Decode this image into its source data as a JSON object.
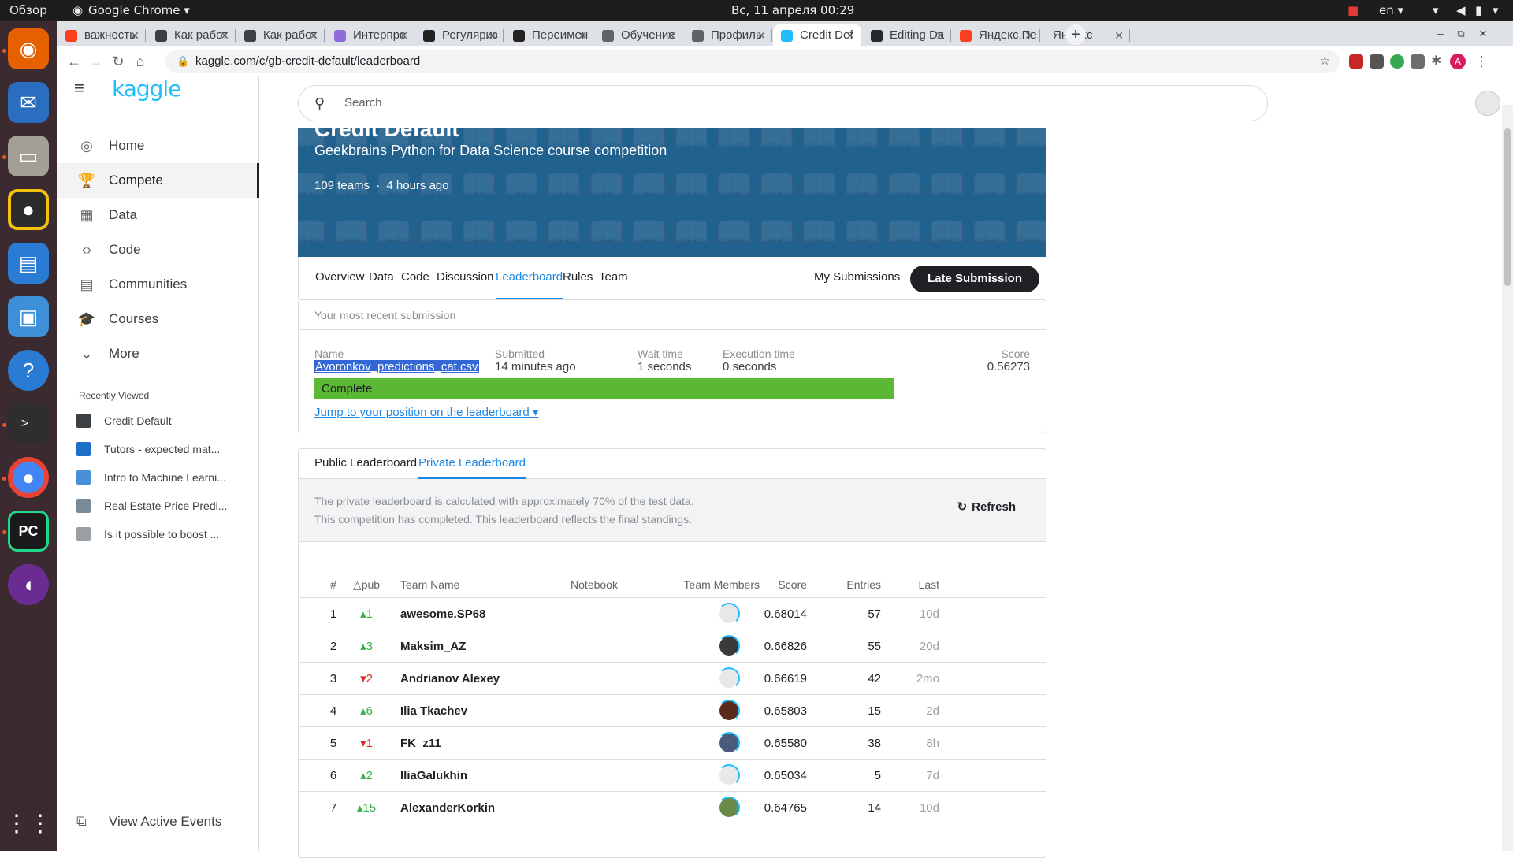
{
  "topbar": {
    "activities": "Обзор",
    "app_menu": "Google Chrome ▾",
    "clock": "Вс, 11 апреля  00:29",
    "lang": "en ▾"
  },
  "browser": {
    "tabs": [
      {
        "label": "важность",
        "favicon_color": "#fc3f1d"
      },
      {
        "label": "Как работ",
        "favicon_color": "#3c4043"
      },
      {
        "label": "Как работ",
        "favicon_color": "#3c4043"
      },
      {
        "label": "Интерпре",
        "favicon_color": "#8e6cd9"
      },
      {
        "label": "Регуляриз",
        "favicon_color": "#222222"
      },
      {
        "label": "Переимен",
        "favicon_color": "#222222"
      },
      {
        "label": "Обучение",
        "favicon_color": "#5f6368"
      },
      {
        "label": "Профиль",
        "favicon_color": "#5f6368"
      },
      {
        "label": "Credit Def",
        "favicon_color": "#20beff"
      },
      {
        "label": "Editing Da",
        "favicon_color": "#24292e"
      },
      {
        "label": "Яндекс.Пе",
        "favicon_color": "#fc3f1d"
      },
      {
        "label": "Яндекс",
        "favicon_color": ""
      }
    ],
    "url": "kaggle.com/c/gb-credit-default/leaderboard",
    "avatar_letter": "A"
  },
  "sidebar": {
    "logo": "kaggle",
    "nav": [
      {
        "label": "Home",
        "icon": "compass-icon",
        "glyph": "◎"
      },
      {
        "label": "Compete",
        "icon": "trophy-icon",
        "glyph": "🏆"
      },
      {
        "label": "Data",
        "icon": "table-icon",
        "glyph": "▦"
      },
      {
        "label": "Code",
        "icon": "code-icon",
        "glyph": "‹›"
      },
      {
        "label": "Communities",
        "icon": "comment-icon",
        "glyph": "▤"
      },
      {
        "label": "Courses",
        "icon": "school-icon",
        "glyph": "🎓"
      },
      {
        "label": "More",
        "icon": "chevron-down-icon",
        "glyph": "⌄"
      }
    ],
    "recently_viewed_title": "Recently Viewed",
    "recent": [
      {
        "label": "Credit Default",
        "color": "#3c4043"
      },
      {
        "label": "Tutors - expected mat...",
        "color": "#1e6fc8"
      },
      {
        "label": "Intro to Machine Learni...",
        "color": "#4a90d9"
      },
      {
        "label": "Real Estate Price Predi...",
        "color": "#7a8a9a"
      },
      {
        "label": "Is it possible to boost ...",
        "color": "#9aa0a6"
      }
    ],
    "view_active_events": "View Active Events"
  },
  "search": {
    "placeholder": "Search"
  },
  "competition": {
    "title": "Credit Default",
    "subtitle": "Geekbrains Python for Data Science course competition",
    "teams": "109 teams",
    "time_ago": "4 hours ago",
    "tabs": [
      "Overview",
      "Data",
      "Code",
      "Discussion",
      "Leaderboard",
      "Rules",
      "Team"
    ],
    "my_submissions": "My Submissions",
    "late_submission": "Late Submission"
  },
  "recent_submission": {
    "header": "Your most recent submission",
    "name_label": "Name",
    "name": "Avoronkov_predictions_cat.csv",
    "submitted_label": "Submitted",
    "submitted": "14 minutes ago",
    "wait_label": "Wait time",
    "wait": "1 seconds",
    "exec_label": "Execution time",
    "exec": "0 seconds",
    "score_label": "Score",
    "score": "0.56273",
    "status": "Complete",
    "jump_link": "Jump to your position on the leaderboard ▾"
  },
  "leaderboard": {
    "tabs": [
      "Public Leaderboard",
      "Private Leaderboard"
    ],
    "info_line1": "The private leaderboard is calculated with approximately 70% of the test data.",
    "info_line2": "This competition has completed. This leaderboard reflects the final standings.",
    "refresh": "Refresh",
    "columns": [
      "#",
      "△pub",
      "Team Name",
      "Notebook",
      "Team Members",
      "Score",
      "Entries",
      "Last"
    ],
    "rows": [
      {
        "rank": "1",
        "delta": "1",
        "dir": "up",
        "team": "awesome.SP68",
        "score": "0.68014",
        "entries": "57",
        "last": "10d",
        "avatar_color": "#e8e8e8"
      },
      {
        "rank": "2",
        "delta": "3",
        "dir": "up",
        "team": "Maksim_AZ",
        "score": "0.66826",
        "entries": "55",
        "last": "20d",
        "avatar_color": "#3a3a3a"
      },
      {
        "rank": "3",
        "delta": "2",
        "dir": "down",
        "team": "Andrianov Alexey",
        "score": "0.66619",
        "entries": "42",
        "last": "2mo",
        "avatar_color": "#e8e8e8"
      },
      {
        "rank": "4",
        "delta": "6",
        "dir": "up",
        "team": "Ilia Tkachev",
        "score": "0.65803",
        "entries": "15",
        "last": "2d",
        "avatar_color": "#5a2a1a"
      },
      {
        "rank": "5",
        "delta": "1",
        "dir": "down",
        "team": "FK_z11",
        "score": "0.65580",
        "entries": "38",
        "last": "8h",
        "avatar_color": "#4a5a7a"
      },
      {
        "rank": "6",
        "delta": "2",
        "dir": "up",
        "team": "IliaGalukhin",
        "score": "0.65034",
        "entries": "5",
        "last": "7d",
        "avatar_color": "#e8e8e8"
      },
      {
        "rank": "7",
        "delta": "15",
        "dir": "up",
        "team": "AlexanderKorkin",
        "score": "0.64765",
        "entries": "14",
        "last": "10d",
        "avatar_color": "#6a8a4a"
      }
    ]
  },
  "colors": {
    "kaggle_blue": "#20beff",
    "complete_green": "#5bb834",
    "link_blue": "#1e88e5",
    "up": "#35b146",
    "down": "#d93025"
  }
}
